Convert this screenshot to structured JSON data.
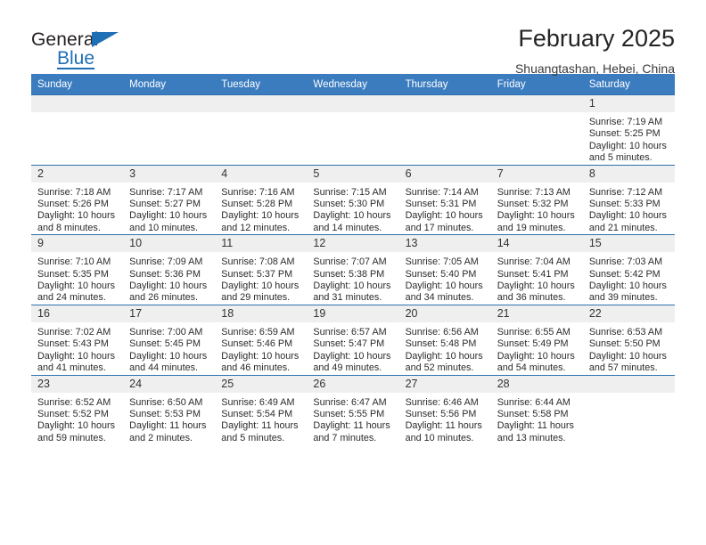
{
  "brand": {
    "name_top": "General",
    "name_bottom": "Blue",
    "flag_icon": "triangle-flag-icon",
    "accent_color": "#1f6fb5"
  },
  "header": {
    "title": "February 2025",
    "subtitle": "Shuangtashan, Hebei, China"
  },
  "theme": {
    "header_row_bg": "#3b7cbf",
    "row_divider": "#2f6fae",
    "daynum_bg": "#efefef"
  },
  "calendar": {
    "weekday_headers": [
      "Sunday",
      "Monday",
      "Tuesday",
      "Wednesday",
      "Thursday",
      "Friday",
      "Saturday"
    ],
    "weeks": [
      [
        {
          "day": "",
          "lines": []
        },
        {
          "day": "",
          "lines": []
        },
        {
          "day": "",
          "lines": []
        },
        {
          "day": "",
          "lines": []
        },
        {
          "day": "",
          "lines": []
        },
        {
          "day": "",
          "lines": []
        },
        {
          "day": "1",
          "lines": [
            "Sunrise: 7:19 AM",
            "Sunset: 5:25 PM",
            "Daylight: 10 hours and 5 minutes."
          ]
        }
      ],
      [
        {
          "day": "2",
          "lines": [
            "Sunrise: 7:18 AM",
            "Sunset: 5:26 PM",
            "Daylight: 10 hours and 8 minutes."
          ]
        },
        {
          "day": "3",
          "lines": [
            "Sunrise: 7:17 AM",
            "Sunset: 5:27 PM",
            "Daylight: 10 hours and 10 minutes."
          ]
        },
        {
          "day": "4",
          "lines": [
            "Sunrise: 7:16 AM",
            "Sunset: 5:28 PM",
            "Daylight: 10 hours and 12 minutes."
          ]
        },
        {
          "day": "5",
          "lines": [
            "Sunrise: 7:15 AM",
            "Sunset: 5:30 PM",
            "Daylight: 10 hours and 14 minutes."
          ]
        },
        {
          "day": "6",
          "lines": [
            "Sunrise: 7:14 AM",
            "Sunset: 5:31 PM",
            "Daylight: 10 hours and 17 minutes."
          ]
        },
        {
          "day": "7",
          "lines": [
            "Sunrise: 7:13 AM",
            "Sunset: 5:32 PM",
            "Daylight: 10 hours and 19 minutes."
          ]
        },
        {
          "day": "8",
          "lines": [
            "Sunrise: 7:12 AM",
            "Sunset: 5:33 PM",
            "Daylight: 10 hours and 21 minutes."
          ]
        }
      ],
      [
        {
          "day": "9",
          "lines": [
            "Sunrise: 7:10 AM",
            "Sunset: 5:35 PM",
            "Daylight: 10 hours and 24 minutes."
          ]
        },
        {
          "day": "10",
          "lines": [
            "Sunrise: 7:09 AM",
            "Sunset: 5:36 PM",
            "Daylight: 10 hours and 26 minutes."
          ]
        },
        {
          "day": "11",
          "lines": [
            "Sunrise: 7:08 AM",
            "Sunset: 5:37 PM",
            "Daylight: 10 hours and 29 minutes."
          ]
        },
        {
          "day": "12",
          "lines": [
            "Sunrise: 7:07 AM",
            "Sunset: 5:38 PM",
            "Daylight: 10 hours and 31 minutes."
          ]
        },
        {
          "day": "13",
          "lines": [
            "Sunrise: 7:05 AM",
            "Sunset: 5:40 PM",
            "Daylight: 10 hours and 34 minutes."
          ]
        },
        {
          "day": "14",
          "lines": [
            "Sunrise: 7:04 AM",
            "Sunset: 5:41 PM",
            "Daylight: 10 hours and 36 minutes."
          ]
        },
        {
          "day": "15",
          "lines": [
            "Sunrise: 7:03 AM",
            "Sunset: 5:42 PM",
            "Daylight: 10 hours and 39 minutes."
          ]
        }
      ],
      [
        {
          "day": "16",
          "lines": [
            "Sunrise: 7:02 AM",
            "Sunset: 5:43 PM",
            "Daylight: 10 hours and 41 minutes."
          ]
        },
        {
          "day": "17",
          "lines": [
            "Sunrise: 7:00 AM",
            "Sunset: 5:45 PM",
            "Daylight: 10 hours and 44 minutes."
          ]
        },
        {
          "day": "18",
          "lines": [
            "Sunrise: 6:59 AM",
            "Sunset: 5:46 PM",
            "Daylight: 10 hours and 46 minutes."
          ]
        },
        {
          "day": "19",
          "lines": [
            "Sunrise: 6:57 AM",
            "Sunset: 5:47 PM",
            "Daylight: 10 hours and 49 minutes."
          ]
        },
        {
          "day": "20",
          "lines": [
            "Sunrise: 6:56 AM",
            "Sunset: 5:48 PM",
            "Daylight: 10 hours and 52 minutes."
          ]
        },
        {
          "day": "21",
          "lines": [
            "Sunrise: 6:55 AM",
            "Sunset: 5:49 PM",
            "Daylight: 10 hours and 54 minutes."
          ]
        },
        {
          "day": "22",
          "lines": [
            "Sunrise: 6:53 AM",
            "Sunset: 5:50 PM",
            "Daylight: 10 hours and 57 minutes."
          ]
        }
      ],
      [
        {
          "day": "23",
          "lines": [
            "Sunrise: 6:52 AM",
            "Sunset: 5:52 PM",
            "Daylight: 10 hours and 59 minutes."
          ]
        },
        {
          "day": "24",
          "lines": [
            "Sunrise: 6:50 AM",
            "Sunset: 5:53 PM",
            "Daylight: 11 hours and 2 minutes."
          ]
        },
        {
          "day": "25",
          "lines": [
            "Sunrise: 6:49 AM",
            "Sunset: 5:54 PM",
            "Daylight: 11 hours and 5 minutes."
          ]
        },
        {
          "day": "26",
          "lines": [
            "Sunrise: 6:47 AM",
            "Sunset: 5:55 PM",
            "Daylight: 11 hours and 7 minutes."
          ]
        },
        {
          "day": "27",
          "lines": [
            "Sunrise: 6:46 AM",
            "Sunset: 5:56 PM",
            "Daylight: 11 hours and 10 minutes."
          ]
        },
        {
          "day": "28",
          "lines": [
            "Sunrise: 6:44 AM",
            "Sunset: 5:58 PM",
            "Daylight: 11 hours and 13 minutes."
          ]
        },
        {
          "day": "",
          "lines": []
        }
      ]
    ]
  }
}
